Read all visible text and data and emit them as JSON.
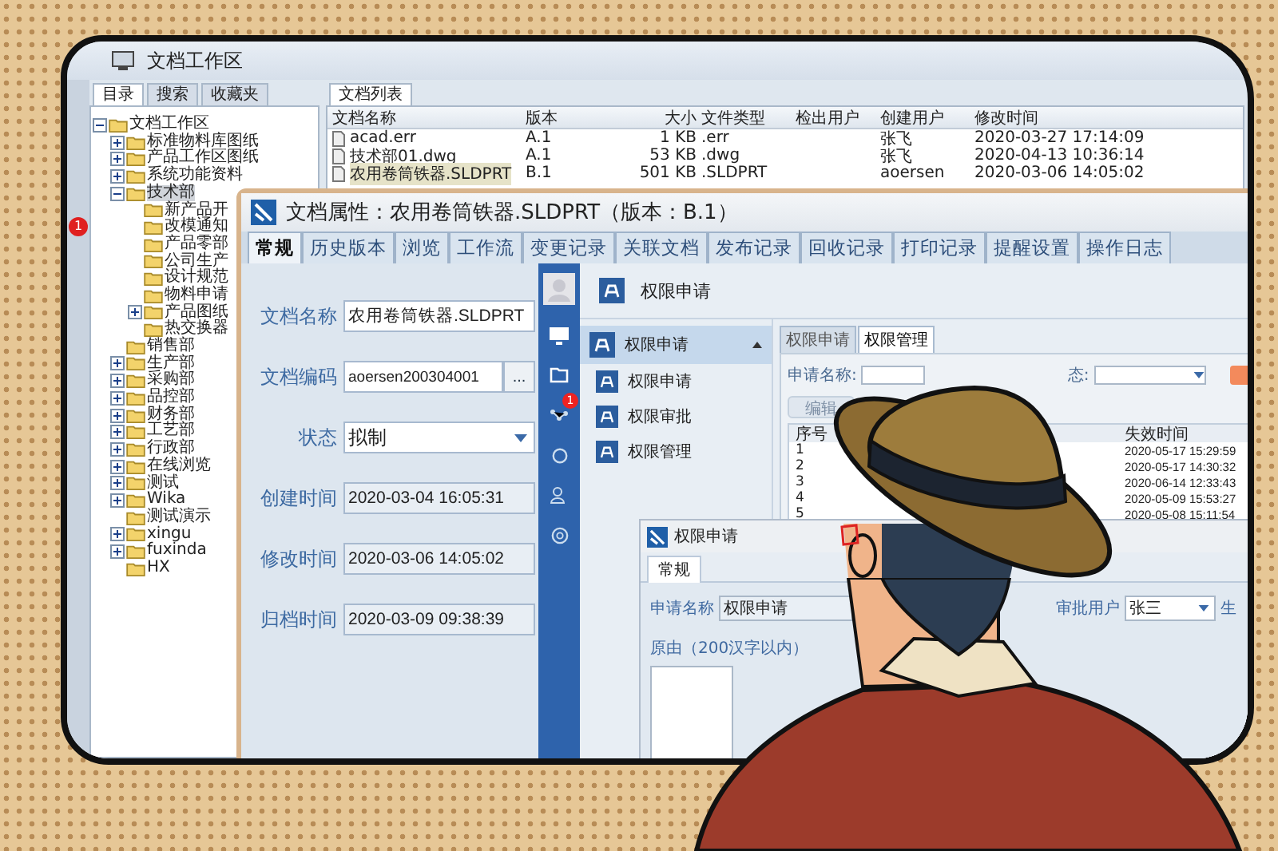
{
  "window": {
    "title": "文档工作区"
  },
  "side_badge": "1",
  "left_tabs": [
    {
      "label": "目录",
      "selected": true
    },
    {
      "label": "搜索",
      "selected": false
    },
    {
      "label": "收藏夹",
      "selected": false
    }
  ],
  "tree": [
    {
      "label": "文档工作区",
      "expanded": true,
      "selected": false,
      "children": [
        {
          "label": "标准物料库图纸",
          "expanded": false,
          "selected": false
        },
        {
          "label": "产品工作区图纸",
          "expanded": false,
          "selected": false
        },
        {
          "label": "系统功能资料",
          "expanded": false,
          "selected": false
        },
        {
          "label": "技术部",
          "expanded": true,
          "selected": true,
          "children": [
            {
              "label": "新产品开",
              "selected": false
            },
            {
              "label": "改模通知",
              "selected": false
            },
            {
              "label": "产品零部",
              "selected": false
            },
            {
              "label": "公司生产",
              "selected": false
            },
            {
              "label": "设计规范",
              "selected": false
            },
            {
              "label": "物料申请",
              "selected": false
            },
            {
              "label": "产品图纸",
              "expanded": false,
              "selected": false
            },
            {
              "label": "热交换器",
              "selected": false
            }
          ]
        },
        {
          "label": "销售部",
          "selected": false
        },
        {
          "label": "生产部",
          "expanded": false,
          "selected": false
        },
        {
          "label": "采购部",
          "expanded": false,
          "selected": false
        },
        {
          "label": "品控部",
          "expanded": false,
          "selected": false
        },
        {
          "label": "财务部",
          "expanded": false,
          "selected": false
        },
        {
          "label": "工艺部",
          "expanded": false,
          "selected": false
        },
        {
          "label": "行政部",
          "expanded": false,
          "selected": false
        },
        {
          "label": "在线浏览",
          "expanded": false,
          "selected": false
        },
        {
          "label": "测试",
          "expanded": false,
          "selected": false
        },
        {
          "label": "Wika",
          "expanded": false,
          "selected": false
        },
        {
          "label": "测试演示",
          "selected": false
        },
        {
          "label": "xingu",
          "expanded": false,
          "selected": false
        },
        {
          "label": "fuxinda",
          "expanded": false,
          "selected": false
        },
        {
          "label": "HX",
          "selected": false
        }
      ]
    }
  ],
  "doc_list": {
    "tab": "文档列表",
    "columns": [
      "文档名称",
      "版本",
      "大小",
      "文件类型",
      "检出用户",
      "创建用户",
      "修改时间"
    ],
    "rows": [
      {
        "name": "acad.err",
        "version": "A.1",
        "size": "1 KB",
        "type": ".err",
        "creator": "张飞",
        "modified": "2020-03-27 17:14:09",
        "selected": false
      },
      {
        "name": "技术部01.dwg",
        "version": "A.1",
        "size": "53 KB",
        "type": ".dwg",
        "creator": "张飞",
        "modified": "2020-04-13 10:36:14",
        "selected": false
      },
      {
        "name": "农用卷筒铁器.SLDPRT",
        "version": "B.1",
        "size": "501 KB",
        "type": ".SLDPRT",
        "creator": "aoersen",
        "modified": "2020-03-06 14:05:02",
        "selected": true
      }
    ]
  },
  "properties": {
    "title": "文档属性：农用卷筒铁器.SLDPRT（版本：B.1）",
    "tabs": [
      {
        "label": "常规",
        "selected": true
      },
      {
        "label": "历史版本",
        "selected": false
      },
      {
        "label": "浏览",
        "selected": false
      },
      {
        "label": "工作流",
        "selected": false
      },
      {
        "label": "变更记录",
        "selected": false
      },
      {
        "label": "关联文档",
        "selected": false
      },
      {
        "label": "发布记录",
        "selected": false
      },
      {
        "label": "回收记录",
        "selected": false
      },
      {
        "label": "打印记录",
        "selected": false
      },
      {
        "label": "提醒设置",
        "selected": false
      },
      {
        "label": "操作日志",
        "selected": false
      }
    ],
    "fields": [
      {
        "kind": "text",
        "label": "文档名称",
        "value": "农用卷筒铁器.SLDPRT"
      },
      {
        "kind": "browse",
        "label": "文档编码",
        "value": "aoersen200304001",
        "button": "..."
      },
      {
        "kind": "select",
        "label": "状态",
        "value": "拟制"
      },
      {
        "kind": "readonly",
        "label": "创建时间",
        "value": "2020-03-04 16:05:31"
      },
      {
        "kind": "readonly",
        "label": "修改时间",
        "value": "2020-03-06 14:05:02"
      },
      {
        "kind": "readonly",
        "label": "归档时间",
        "value": "2020-03-09 09:38:39"
      }
    ]
  },
  "portal": {
    "badge": "1",
    "header": "权限申请",
    "menu": {
      "label": "权限申请",
      "expanded": true,
      "selected": true,
      "items": [
        {
          "label": "权限申请",
          "selected": false
        },
        {
          "label": "权限审批",
          "selected": false
        },
        {
          "label": "权限管理",
          "selected": false
        }
      ]
    },
    "tabs": [
      {
        "label": "权限申请",
        "selected": false
      },
      {
        "label": "权限管理",
        "selected": true
      }
    ],
    "filters": [
      "申请名称:",
      "态:"
    ],
    "buttons": [
      "编辑"
    ],
    "table": {
      "columns": [
        "序号",
        "失效时间"
      ],
      "rows": [
        [
          "1",
          "2020-05-17 15:29:59"
        ],
        [
          "2",
          "2020-05-17 14:30:32"
        ],
        [
          "3",
          "2020-06-14 12:33:43"
        ],
        [
          "4",
          "2020-05-09 15:53:27"
        ],
        [
          "5",
          "2020-05-08 15:11:54"
        ]
      ]
    }
  },
  "request_dialog": {
    "title": "权限申请",
    "tab": "常规",
    "name_label": "申请名称",
    "name_value": "权限申请",
    "approver_label": "审批用户",
    "approver_value": "张三",
    "cut_label": "生",
    "reason_label": "原由（200汉字以内）"
  }
}
